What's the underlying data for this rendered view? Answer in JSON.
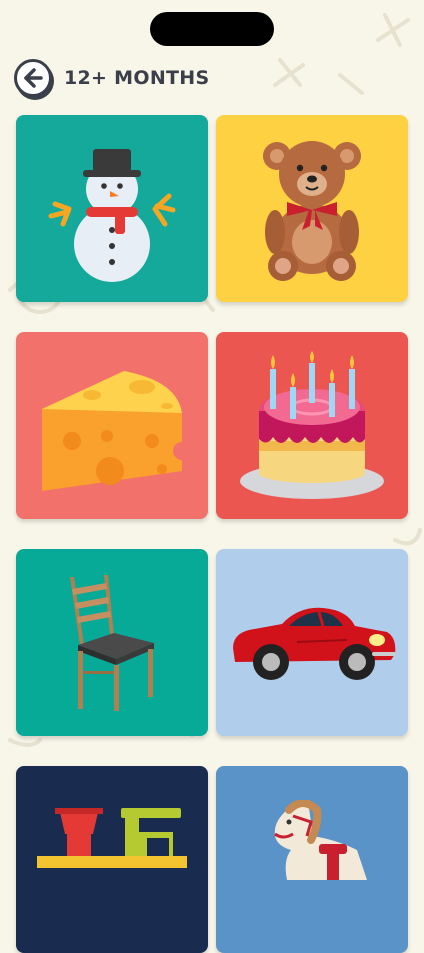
{
  "status_bar": {
    "time": "",
    "icons": ""
  },
  "header": {
    "title": "12+ MONTHS",
    "back_icon": "arrow-left-icon"
  },
  "tiles": [
    {
      "name": "snowman",
      "icon": "snowman-icon",
      "color": "#14a99b"
    },
    {
      "name": "teddy-bear",
      "icon": "teddy-bear-icon",
      "color": "#fdd142"
    },
    {
      "name": "cheese",
      "icon": "cheese-icon",
      "color": "#f3716b"
    },
    {
      "name": "birthday-cake",
      "icon": "birthday-cake-icon",
      "color": "#ec5651"
    },
    {
      "name": "chair",
      "icon": "chair-icon",
      "color": "#07a997"
    },
    {
      "name": "car",
      "icon": "car-icon",
      "color": "#b0cdeb"
    },
    {
      "name": "toy-train",
      "icon": "toy-train-icon",
      "color": "#1a2b50"
    },
    {
      "name": "rocking-horse",
      "icon": "rocking-horse-icon",
      "color": "#5a93c7"
    }
  ],
  "colors": {
    "background": "#f8f5e9",
    "title": "#3a3f4a"
  }
}
